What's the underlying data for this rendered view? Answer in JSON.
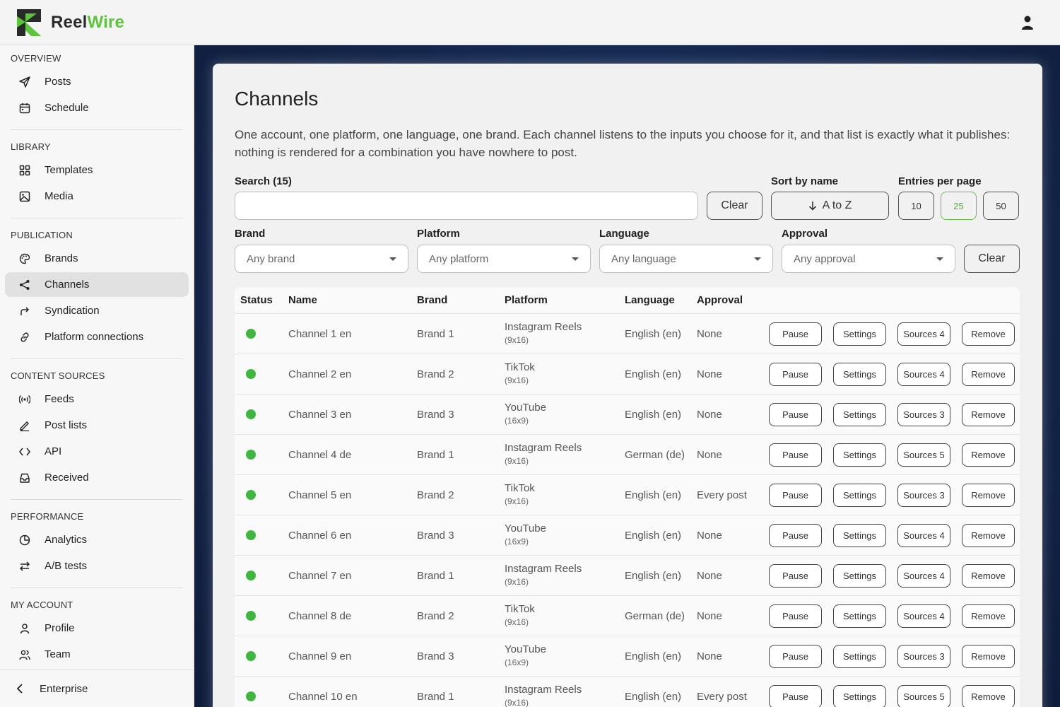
{
  "app": {
    "name_part1": "Reel",
    "name_part2": "Wire",
    "accent_color": "#5ec43e"
  },
  "sidebar": {
    "sections": [
      {
        "title": "OVERVIEW",
        "items": [
          {
            "label": "Posts",
            "icon": "send-icon"
          },
          {
            "label": "Schedule",
            "icon": "calendar-icon"
          }
        ]
      },
      {
        "title": "LIBRARY",
        "items": [
          {
            "label": "Templates",
            "icon": "grid-icon"
          },
          {
            "label": "Media",
            "icon": "image-icon"
          }
        ]
      },
      {
        "title": "PUBLICATION",
        "items": [
          {
            "label": "Brands",
            "icon": "palette-icon"
          },
          {
            "label": "Channels",
            "icon": "share-icon",
            "active": true
          },
          {
            "label": "Syndication",
            "icon": "forward-icon"
          },
          {
            "label": "Platform connections",
            "icon": "link-icon"
          }
        ]
      },
      {
        "title": "CONTENT SOURCES",
        "items": [
          {
            "label": "Feeds",
            "icon": "broadcast-icon"
          },
          {
            "label": "Post lists",
            "icon": "pencil-icon"
          },
          {
            "label": "API",
            "icon": "code-icon"
          },
          {
            "label": "Received",
            "icon": "inbox-icon"
          }
        ]
      },
      {
        "title": "PERFORMANCE",
        "items": [
          {
            "label": "Analytics",
            "icon": "pie-chart-icon"
          },
          {
            "label": "A/B tests",
            "icon": "swap-icon"
          }
        ]
      },
      {
        "title": "MY ACCOUNT",
        "items": [
          {
            "label": "Profile",
            "icon": "user-icon"
          },
          {
            "label": "Team",
            "icon": "users-icon"
          }
        ]
      }
    ],
    "footer_label": "Enterprise"
  },
  "page": {
    "title": "Channels",
    "description": "One account, one platform, one language, one brand. Each channel listens to the inputs you choose for it, and that list is exactly what it publishes: nothing is rendered for a combination you have nowhere to post."
  },
  "search": {
    "label": "Search (15)",
    "value": "",
    "clear_label": "Clear"
  },
  "sort": {
    "label": "Sort by name",
    "value": "A to Z"
  },
  "entries": {
    "label": "Entries per page",
    "options": [
      "10",
      "25",
      "50"
    ],
    "selected": "25"
  },
  "filters": {
    "brand": {
      "label": "Brand",
      "value": "Any brand"
    },
    "platform": {
      "label": "Platform",
      "value": "Any platform"
    },
    "language": {
      "label": "Language",
      "value": "Any language"
    },
    "approval": {
      "label": "Approval",
      "value": "Any approval"
    },
    "clear_label": "Clear"
  },
  "table": {
    "headers": {
      "status": "Status",
      "name": "Name",
      "brand": "Brand",
      "platform": "Platform",
      "language": "Language",
      "approval": "Approval"
    },
    "action_labels": {
      "pause": "Pause",
      "settings": "Settings",
      "remove": "Remove"
    },
    "status_color": "#3fb73f",
    "rows": [
      {
        "name": "Channel 1 en",
        "brand": "Brand 1",
        "platform": "Instagram Reels",
        "format": "(9x16)",
        "language": "English (en)",
        "approval": "None",
        "sources": "Sources 4"
      },
      {
        "name": "Channel 2 en",
        "brand": "Brand 2",
        "platform": "TikTok",
        "format": "(9x16)",
        "language": "English (en)",
        "approval": "None",
        "sources": "Sources 4"
      },
      {
        "name": "Channel 3 en",
        "brand": "Brand 3",
        "platform": "YouTube",
        "format": "(16x9)",
        "language": "English (en)",
        "approval": "None",
        "sources": "Sources 3"
      },
      {
        "name": "Channel 4 de",
        "brand": "Brand 1",
        "platform": "Instagram Reels",
        "format": "(9x16)",
        "language": "German (de)",
        "approval": "None",
        "sources": "Sources 5"
      },
      {
        "name": "Channel 5 en",
        "brand": "Brand 2",
        "platform": "TikTok",
        "format": "(9x16)",
        "language": "English (en)",
        "approval": "Every post",
        "sources": "Sources 3"
      },
      {
        "name": "Channel 6 en",
        "brand": "Brand 3",
        "platform": "YouTube",
        "format": "(16x9)",
        "language": "English (en)",
        "approval": "None",
        "sources": "Sources 4"
      },
      {
        "name": "Channel 7 en",
        "brand": "Brand 1",
        "platform": "Instagram Reels",
        "format": "(9x16)",
        "language": "English (en)",
        "approval": "None",
        "sources": "Sources 4"
      },
      {
        "name": "Channel 8 de",
        "brand": "Brand 2",
        "platform": "TikTok",
        "format": "(9x16)",
        "language": "German (de)",
        "approval": "None",
        "sources": "Sources 4"
      },
      {
        "name": "Channel 9 en",
        "brand": "Brand 3",
        "platform": "YouTube",
        "format": "(16x9)",
        "language": "English (en)",
        "approval": "None",
        "sources": "Sources 3"
      },
      {
        "name": "Channel 10 en",
        "brand": "Brand 1",
        "platform": "Instagram Reels",
        "format": "(9x16)",
        "language": "English (en)",
        "approval": "Every post",
        "sources": "Sources 5"
      }
    ]
  }
}
